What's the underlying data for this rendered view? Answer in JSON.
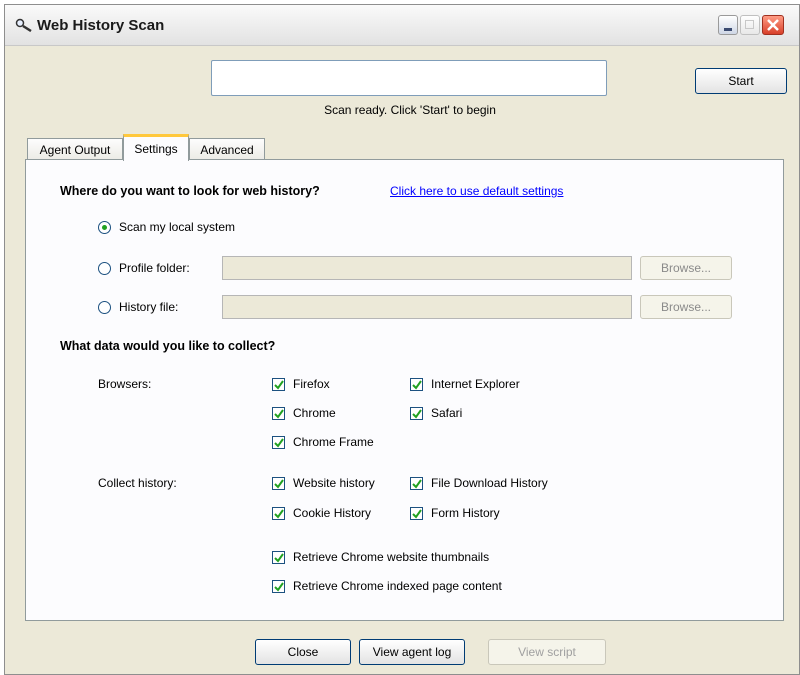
{
  "window": {
    "title": "Web History Scan"
  },
  "scan": {
    "status": "Scan ready.  Click 'Start' to begin",
    "start_label": "Start",
    "progress": 0
  },
  "tabs": [
    {
      "label": "Agent Output"
    },
    {
      "label": "Settings"
    },
    {
      "label": "Advanced"
    }
  ],
  "settings": {
    "where_heading": "Where do you want to look for web history?",
    "default_link": "Click here to use default settings",
    "options": {
      "local": {
        "label": "Scan my local system",
        "selected": true
      },
      "profile": {
        "label": "Profile folder:",
        "selected": false,
        "value": "",
        "browse_label": "Browse..."
      },
      "history": {
        "label": "History file:",
        "selected": false,
        "value": "",
        "browse_label": "Browse..."
      }
    },
    "collect_heading": "What data would you like to collect?",
    "browsers_label": "Browsers:",
    "browsers": {
      "firefox": {
        "label": "Firefox",
        "checked": true
      },
      "ie": {
        "label": "Internet Explorer",
        "checked": true
      },
      "chrome": {
        "label": "Chrome",
        "checked": true
      },
      "safari": {
        "label": "Safari",
        "checked": true
      },
      "chrome_frame": {
        "label": "Chrome Frame",
        "checked": true
      }
    },
    "history_label": "Collect history:",
    "history": {
      "website": {
        "label": "Website history",
        "checked": true
      },
      "download": {
        "label": "File Download History",
        "checked": true
      },
      "cookie": {
        "label": "Cookie History",
        "checked": true
      },
      "form": {
        "label": "Form History",
        "checked": true
      },
      "thumbs": {
        "label": "Retrieve Chrome website thumbnails",
        "checked": true
      },
      "indexed": {
        "label": "Retrieve Chrome indexed page content",
        "checked": true
      }
    }
  },
  "footer": {
    "close_label": "Close",
    "log_label": "View agent log",
    "script_label": "View script"
  },
  "colors": {
    "link": "#0000ff",
    "check": "#21a121",
    "tab_accent": "#ffc83c",
    "close_button": "#d8402a"
  },
  "icons": {
    "app": "magnifier-icon",
    "check": "checkmark-icon"
  }
}
